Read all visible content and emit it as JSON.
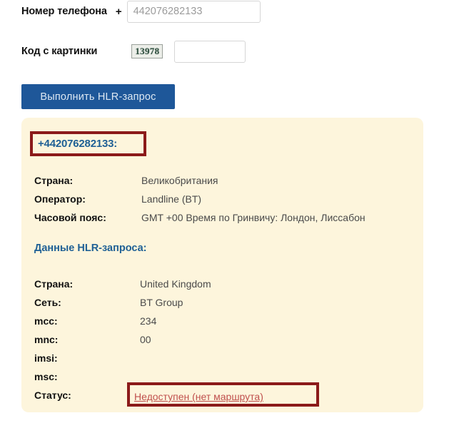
{
  "form": {
    "phone": {
      "label": "Номер телефона",
      "plus": "+",
      "value": "442076282133",
      "placeholder": "442076282133"
    },
    "captcha": {
      "label": "Код с картинки",
      "image_text": "13978",
      "input_value": "",
      "placeholder": ""
    },
    "submit_label": "Выполнить HLR-запрос"
  },
  "result": {
    "phone_heading": "+442076282133:",
    "basic_info": [
      {
        "label": "Страна:",
        "value": "Великобритания"
      },
      {
        "label": "Оператор:",
        "value": "Landline (BT)"
      },
      {
        "label": "Часовой пояс:",
        "value": "GMT +00 Время по Гринвичу: Лондон, Лиссабон"
      }
    ],
    "hlr_heading": "Данные HLR-запроса:",
    "hlr_info": [
      {
        "label": "Страна:",
        "value": "United Kingdom"
      },
      {
        "label": "Сеть:",
        "value": "BT Group"
      },
      {
        "label": "mcc:",
        "value": "234"
      },
      {
        "label": "mnc:",
        "value": "00"
      },
      {
        "label": "imsi:",
        "value": ""
      },
      {
        "label": "msc:",
        "value": ""
      }
    ],
    "status_label": "Статус:",
    "status_value": "Недоступен (нет маршрута)"
  },
  "colors": {
    "panel_bg": "#fdf5dc",
    "accent_blue": "#1f6095",
    "button_blue": "#1e5799",
    "annotation_red": "#8b1a1a",
    "status_red": "#c0504d",
    "page_bg": "#ffffff"
  }
}
